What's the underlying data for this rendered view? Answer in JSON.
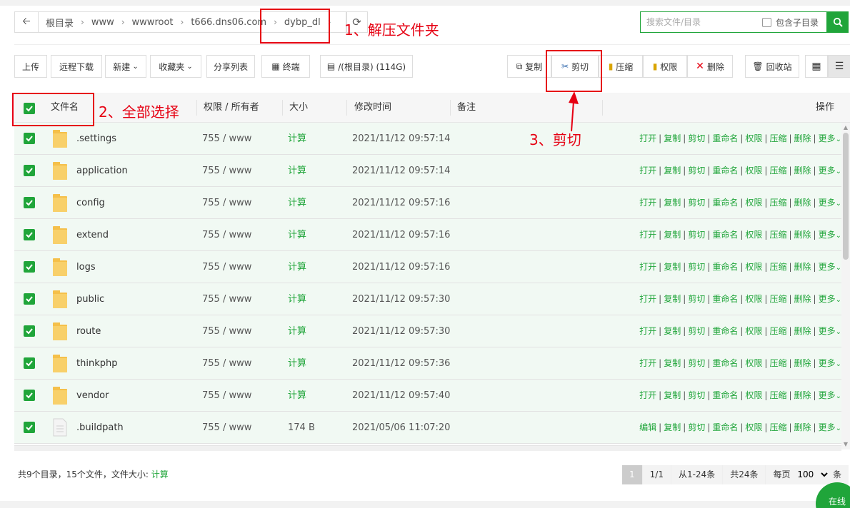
{
  "breadcrumb": {
    "items": [
      "根目录",
      "www",
      "wwwroot",
      "t666.dns06.com",
      "dybp_dl"
    ]
  },
  "search": {
    "placeholder": "搜索文件/目录",
    "include_sub_label": "包含子目录"
  },
  "toolbar": {
    "upload": "上传",
    "remote_download": "远程下载",
    "new": "新建",
    "favorites": "收藏夹",
    "share_list": "分享列表",
    "terminal": "终端",
    "disk": "/(根目录) (114G)",
    "copy": "复制",
    "cut": "剪切",
    "compress": "压缩",
    "permission": "权限",
    "delete": "删除",
    "recycle": "回收站"
  },
  "table": {
    "headers": {
      "name": "文件名",
      "perm": "权限 / 所有者",
      "size": "大小",
      "mtime": "修改时间",
      "remark": "备注",
      "ops": "操作"
    },
    "rows": [
      {
        "name": ".settings",
        "perm": "755 / www",
        "size": "计算",
        "mtime": "2021/11/12 09:57:14",
        "first_op": "打开",
        "type": "folder"
      },
      {
        "name": "application",
        "perm": "755 / www",
        "size": "计算",
        "mtime": "2021/11/12 09:57:14",
        "first_op": "打开",
        "type": "folder"
      },
      {
        "name": "config",
        "perm": "755 / www",
        "size": "计算",
        "mtime": "2021/11/12 09:57:16",
        "first_op": "打开",
        "type": "folder"
      },
      {
        "name": "extend",
        "perm": "755 / www",
        "size": "计算",
        "mtime": "2021/11/12 09:57:16",
        "first_op": "打开",
        "type": "folder"
      },
      {
        "name": "logs",
        "perm": "755 / www",
        "size": "计算",
        "mtime": "2021/11/12 09:57:16",
        "first_op": "打开",
        "type": "folder"
      },
      {
        "name": "public",
        "perm": "755 / www",
        "size": "计算",
        "mtime": "2021/11/12 09:57:30",
        "first_op": "打开",
        "type": "folder"
      },
      {
        "name": "route",
        "perm": "755 / www",
        "size": "计算",
        "mtime": "2021/11/12 09:57:30",
        "first_op": "打开",
        "type": "folder"
      },
      {
        "name": "thinkphp",
        "perm": "755 / www",
        "size": "计算",
        "mtime": "2021/11/12 09:57:36",
        "first_op": "打开",
        "type": "folder"
      },
      {
        "name": "vendor",
        "perm": "755 / www",
        "size": "计算",
        "mtime": "2021/11/12 09:57:40",
        "first_op": "打开",
        "type": "folder"
      },
      {
        "name": ".buildpath",
        "perm": "755 / www",
        "size": "174 B",
        "mtime": "2021/05/06 11:07:20",
        "first_op": "编辑",
        "type": "file"
      }
    ],
    "row_ops": [
      "复制",
      "剪切",
      "重命名",
      "权限",
      "压缩",
      "删除",
      "更多"
    ]
  },
  "footer": {
    "summary": "共9个目录，15个文件，文件大小:",
    "calc": "计算",
    "page_current": "1",
    "page_total": "1/1",
    "range": "从1-24条",
    "total": "共24条",
    "per_page_label": "每页",
    "per_page": "100",
    "unit": "条"
  },
  "online": "在线",
  "annotations": {
    "step1": "1、解压文件夹",
    "step2": "2、全部选择",
    "step3": "3、剪切"
  },
  "colors": {
    "brand_green": "#20a53a",
    "annotation_red": "#e60012",
    "folder_yellow": "#f5c04a"
  }
}
